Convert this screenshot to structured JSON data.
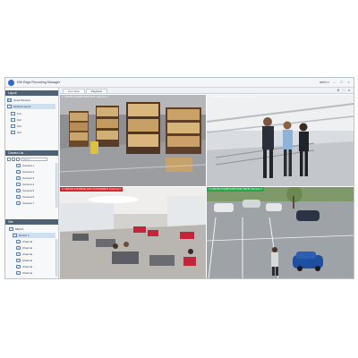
{
  "window": {
    "title": "DW Edge Recording Manager",
    "user": "admin ▾",
    "minimize": "–",
    "maximize": "□",
    "close": "×"
  },
  "sidebar": {
    "layout_panel": {
      "title": "Layout",
      "items": [
        {
          "label": "Quad Window",
          "icon": "grid-icon"
        },
        {
          "label": "Default Layout",
          "icon": "layout-icon",
          "selected": true
        },
        {
          "label": "1x1",
          "icon": "layout-icon"
        },
        {
          "label": "2x2",
          "icon": "layout-icon"
        },
        {
          "label": "3x3",
          "icon": "layout-icon"
        },
        {
          "label": "4x4",
          "icon": "layout-icon"
        }
      ]
    },
    "camera_panel": {
      "title": "Camera List",
      "search_placeholder": "Search",
      "items": [
        {
          "label": "Camera 1"
        },
        {
          "label": "Camera 2"
        },
        {
          "label": "Camera 3"
        },
        {
          "label": "Camera 4"
        },
        {
          "label": "Camera 5"
        },
        {
          "label": "Camera 6"
        },
        {
          "label": "Camera 7"
        }
      ]
    },
    "device_panel": {
      "title": "Site",
      "tree_root": "MEVIX",
      "tree_child": "Device 1",
      "items": [
        {
          "label": "Channel"
        },
        {
          "label": "Channel"
        },
        {
          "label": "Channel"
        },
        {
          "label": "Channel"
        },
        {
          "label": "Channel"
        },
        {
          "label": "Channel"
        }
      ]
    }
  },
  "main": {
    "tabs": [
      {
        "label": "Live View",
        "active": true
      },
      {
        "label": "Playback",
        "active": false
      }
    ],
    "tools": [
      "⚙",
      "⛶",
      "✕"
    ],
    "tiles": [
      {
        "label": "1: DW-BA7100BTK4BT-B.E. Camera 1",
        "label_color": "#2d2d2d",
        "scene": "warehouse"
      },
      {
        "label": "2: DW-CB7100BTK4BT-B.E. Camera 2",
        "label_color": "#2d2d2d",
        "scene": "business"
      },
      {
        "label": "3: DW-DF-FS1000E-DW-VC4S1000FS Camera 3",
        "label_color": "#d9262b",
        "scene": "lobby"
      },
      {
        "label": "4: DW-BA7100BTK4BT-DW-VB1B Camera 4",
        "label_color": "#26a64a",
        "scene": "parking"
      }
    ]
  },
  "colors": {
    "panel_header": "#4f6275",
    "selection": "#cfe0f3",
    "alarm_red": "#d9262b",
    "motion_green": "#26a64a"
  }
}
